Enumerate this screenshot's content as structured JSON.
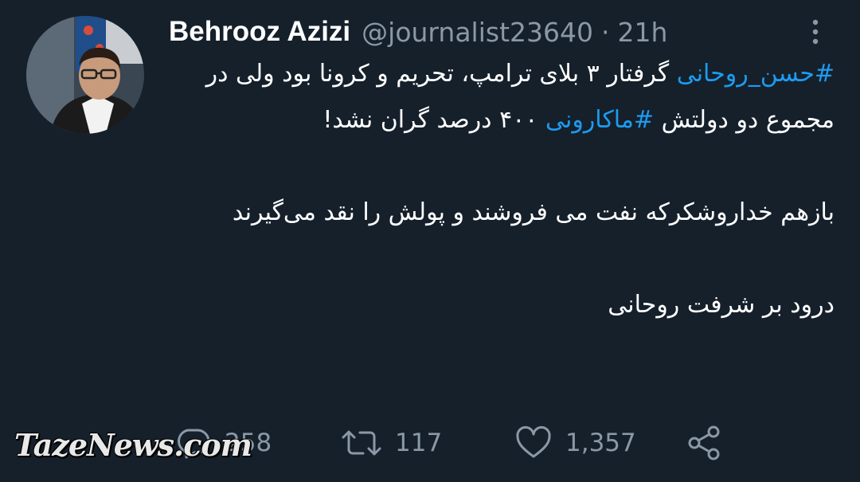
{
  "author": {
    "display_name": "Behrooz Azizi",
    "handle": "@journalist23640",
    "separator": "·",
    "time": "21h"
  },
  "tweet": {
    "segments_line1": {
      "hashtag1": "#حسن_روحانی",
      "text1": " گرفتار ۳ بلای ترامپ، تحریم و کرونا بود ولی در مجموع دو دولتش ",
      "hashtag2": "#ماکارونی",
      "text2": " ۴۰۰ درصد گران نشد!"
    },
    "paragraph2": "بازهم خداروشکرکه نفت می فروشند و پولش را نقد می‌گیرند",
    "paragraph3": "درود بر شرفت روحانی"
  },
  "actions": {
    "replies": "258",
    "retweets": "117",
    "likes": "1,357"
  },
  "watermark": "TazeNews.com",
  "colors": {
    "background": "#15202b",
    "accent": "#1d9bf0",
    "muted": "#8b98a5"
  },
  "icons": [
    "more-vertical-icon",
    "reply-icon",
    "retweet-icon",
    "like-icon",
    "share-icon"
  ]
}
